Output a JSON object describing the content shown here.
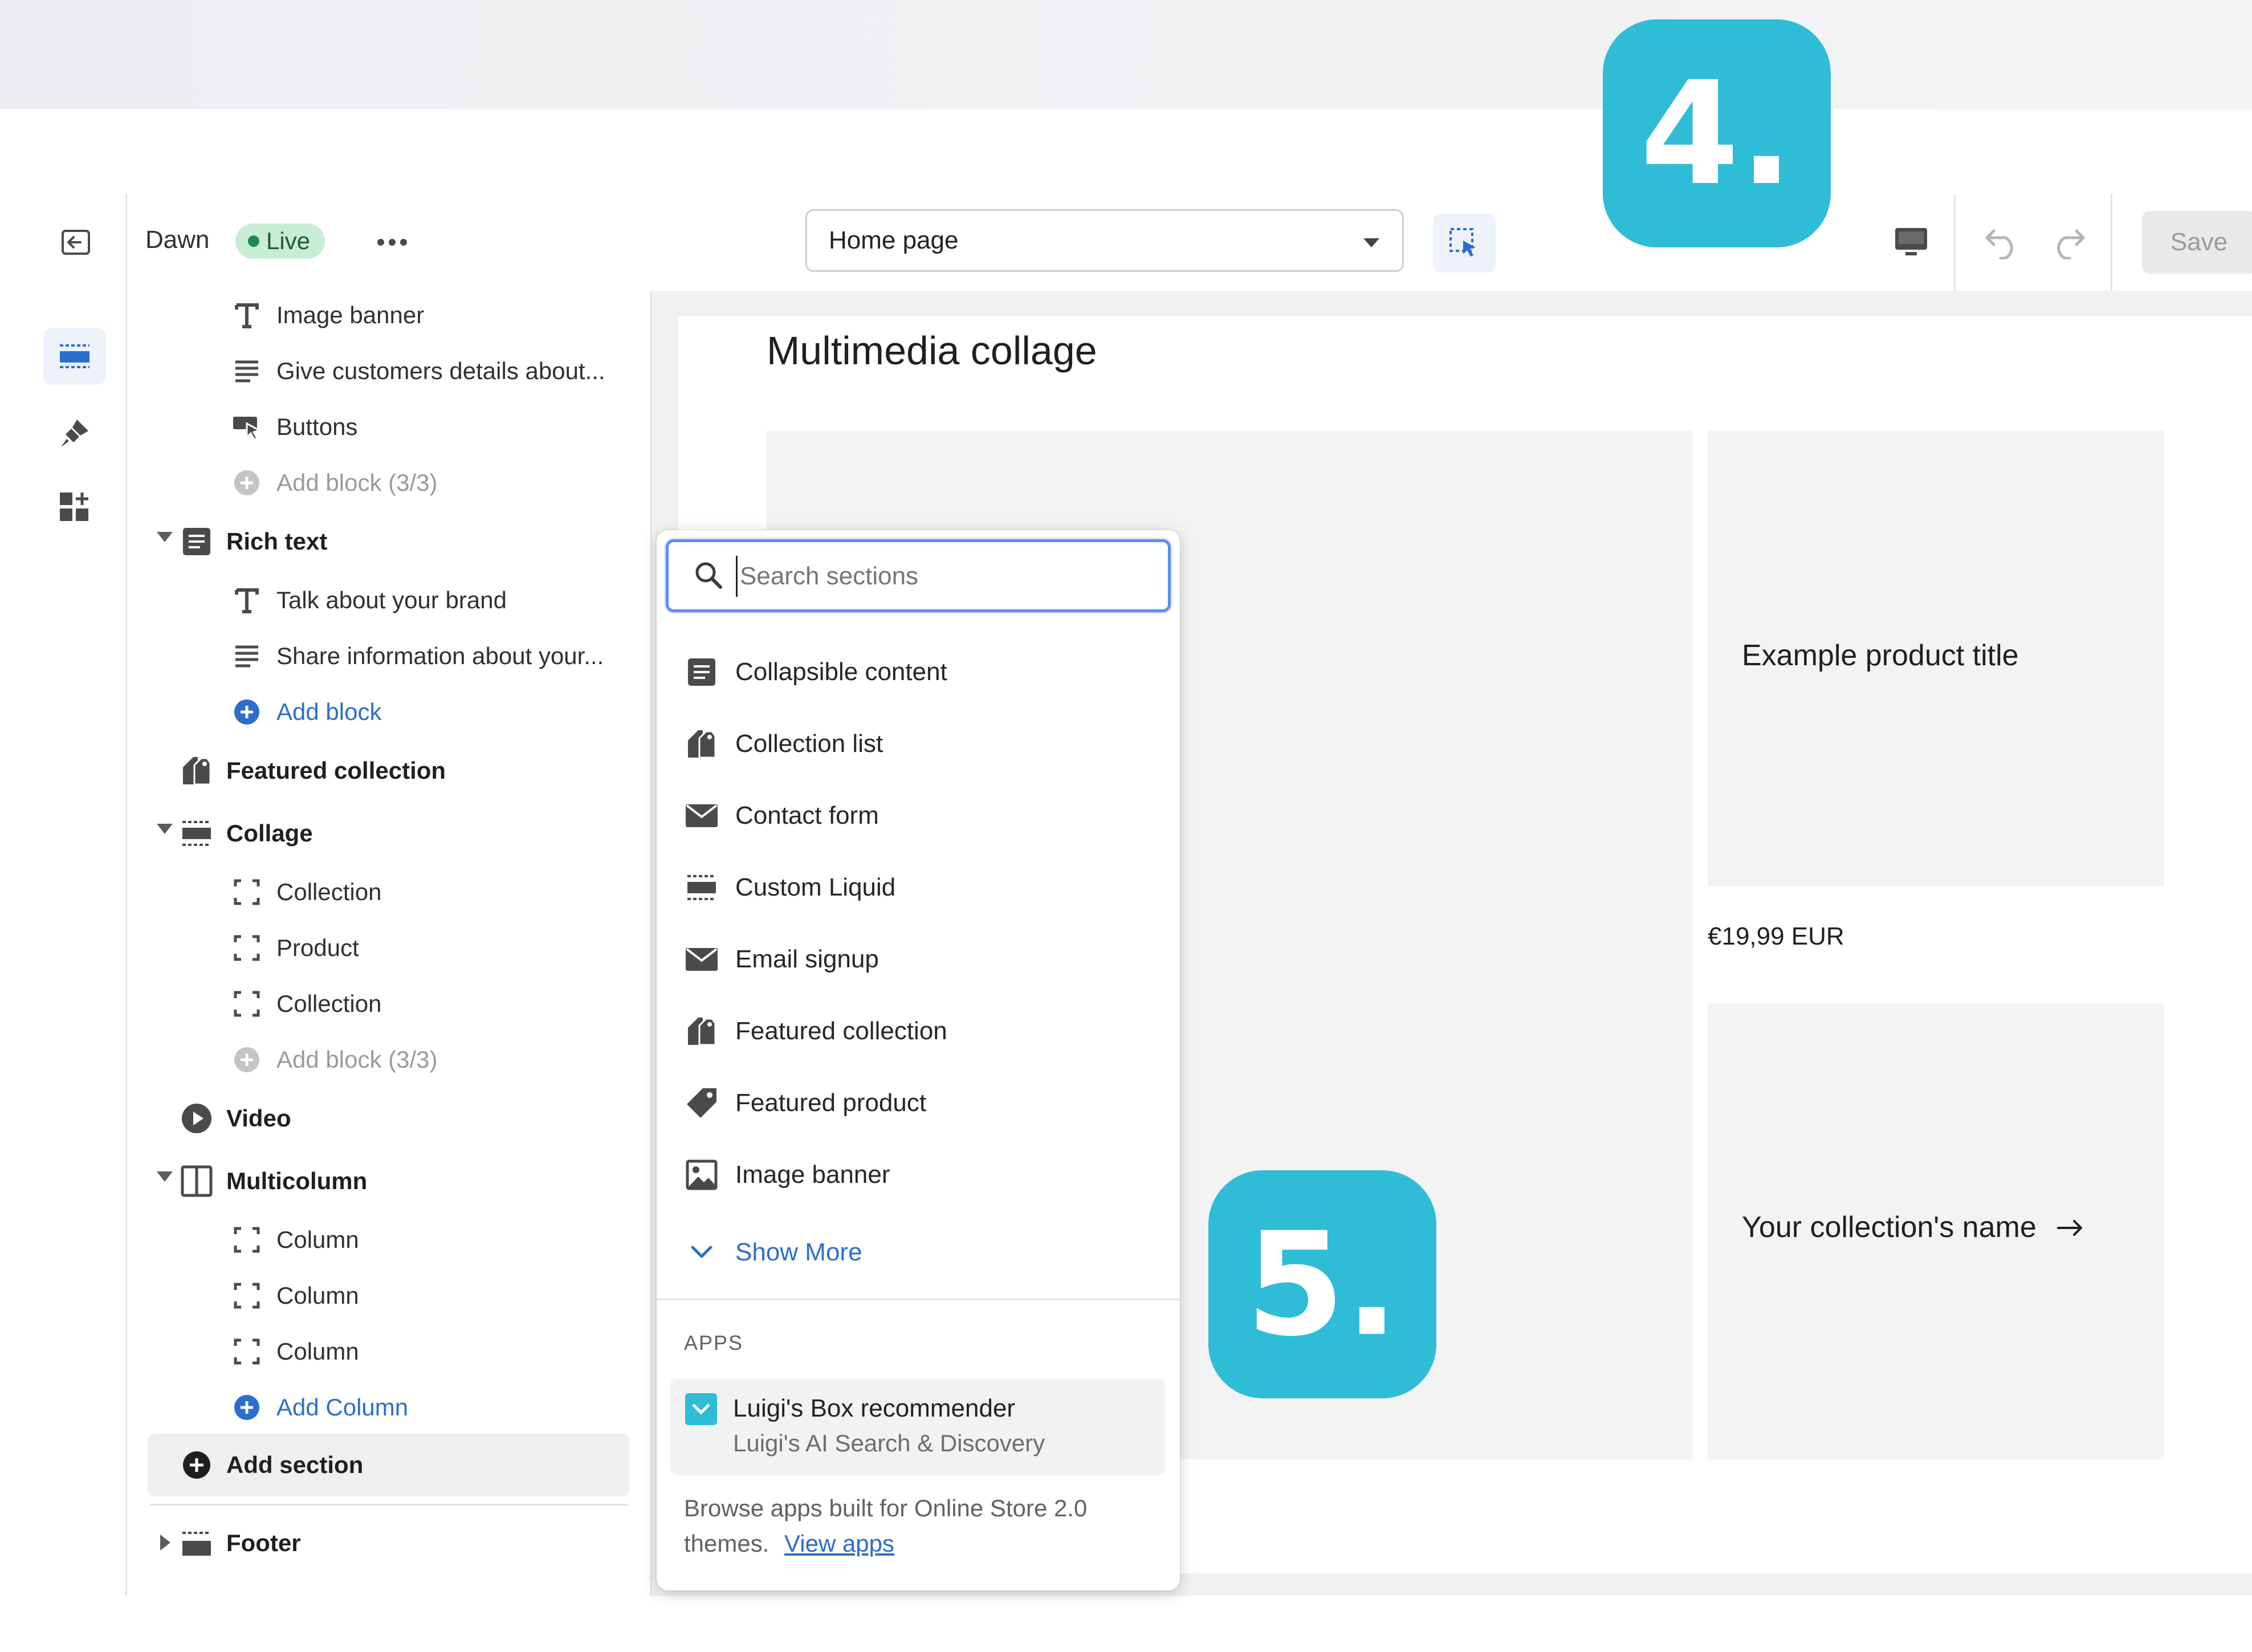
{
  "topbar": {
    "theme_name": "Dawn",
    "status_badge": "Live",
    "page_selector": "Home page",
    "save_label": "Save"
  },
  "sidebar": {
    "items": [
      {
        "label": "Image banner",
        "icon": "text-T-icon"
      },
      {
        "label": "Give customers details about...",
        "icon": "paragraph-icon"
      },
      {
        "label": "Buttons",
        "icon": "button-cursor-icon"
      },
      {
        "label": "Add block (3/3)",
        "icon": "add-circle-icon"
      },
      {
        "label": "Rich text",
        "icon": "text-section-icon"
      },
      {
        "label": "Talk about your brand",
        "icon": "text-T-icon"
      },
      {
        "label": "Share information about your...",
        "icon": "paragraph-icon"
      },
      {
        "label": "Add block",
        "icon": "add-circle-icon"
      },
      {
        "label": "Featured collection",
        "icon": "collection-tag-icon"
      },
      {
        "label": "Collage",
        "icon": "layout-section-icon"
      },
      {
        "label": "Collection",
        "icon": "block-frame-icon"
      },
      {
        "label": "Product",
        "icon": "block-frame-icon"
      },
      {
        "label": "Collection",
        "icon": "block-frame-icon"
      },
      {
        "label": "Add block (3/3)",
        "icon": "add-circle-icon"
      },
      {
        "label": "Video",
        "icon": "play-circle-icon"
      },
      {
        "label": "Multicolumn",
        "icon": "columns-icon"
      },
      {
        "label": "Column",
        "icon": "block-frame-icon"
      },
      {
        "label": "Column",
        "icon": "block-frame-icon"
      },
      {
        "label": "Column",
        "icon": "block-frame-icon"
      },
      {
        "label": "Add Column",
        "icon": "add-circle-icon"
      },
      {
        "label": "Add section",
        "icon": "add-circle-icon"
      },
      {
        "label": "Footer",
        "icon": "layout-section-icon"
      }
    ]
  },
  "popup": {
    "search_placeholder": "Search sections",
    "items": [
      {
        "label": "Collapsible content",
        "icon": "text-section-icon"
      },
      {
        "label": "Collection list",
        "icon": "collection-tag-icon"
      },
      {
        "label": "Contact form",
        "icon": "envelope-icon"
      },
      {
        "label": "Custom Liquid",
        "icon": "layout-section-icon"
      },
      {
        "label": "Email signup",
        "icon": "envelope-icon"
      },
      {
        "label": "Featured collection",
        "icon": "collection-tag-icon"
      },
      {
        "label": "Featured product",
        "icon": "tag-icon"
      },
      {
        "label": "Image banner",
        "icon": "image-icon"
      }
    ],
    "show_more": "Show More",
    "apps_heading": "APPS",
    "app_title": "Luigi's Box recommender",
    "app_subtitle": "Luigi's AI Search & Discovery",
    "browse_text": "Browse apps built for Online Store 2.0 themes.",
    "view_apps": "View apps"
  },
  "preview": {
    "title": "Multimedia collage",
    "product_title": "Example product title",
    "price": "€19,99 EUR",
    "collection_name": "Your collection's name"
  },
  "tiles": {
    "step4": "4.",
    "step5": "5."
  },
  "colors": {
    "accent_teal": "#2fbcd6",
    "live_badge_bg": "#c9ecd4",
    "link_blue": "#2c6ecb",
    "search_focus": "#5b8def"
  }
}
